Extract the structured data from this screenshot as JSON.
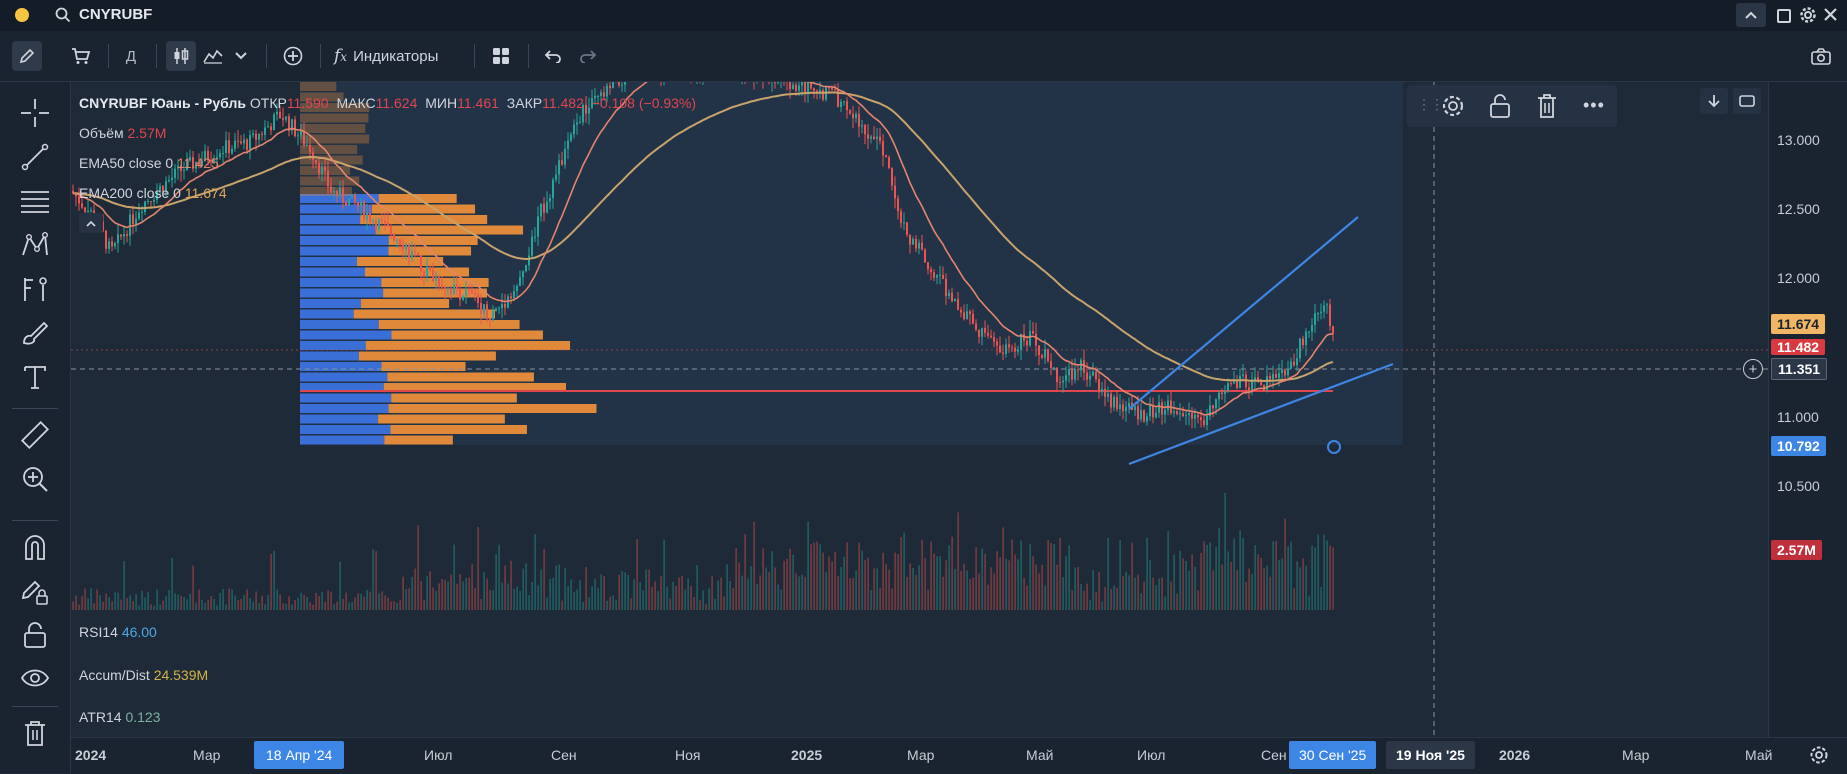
{
  "app": {
    "symbol_search": "CNYRUBF",
    "status_dot_color": "#f5c542"
  },
  "toolbar": {
    "timeframe": "Д",
    "indicators_label": "Индикаторы"
  },
  "legend": {
    "title": "CNYRUBF Юань - Рубль",
    "open_label": "ОТКР",
    "open_value": "11.590",
    "high_label": "МАКС",
    "high_value": "11.624",
    "low_label": "МИН",
    "low_value": "11.461",
    "close_label": "ЗАКР",
    "close_value": "11.482",
    "change": "−0.108 (−0.93%)",
    "volume_label": "Объём",
    "volume_value": "2.57M",
    "ema50_label": "EMA50 close 0",
    "ema50_value": "11.425",
    "ema200_label": "EMA200 close 0",
    "ema200_value": "11.674",
    "rsi_label": "RSI14",
    "rsi_value": "46.00",
    "accum_label": "Accum/Dist",
    "accum_value": "24.539M",
    "atr_label": "ATR14",
    "atr_value": "0.123"
  },
  "price_axis": {
    "ticks": [
      "13.000",
      "12.500",
      "12.000",
      "11.000",
      "10.500"
    ],
    "ema200_badge": "11.674",
    "close_badge": "11.482",
    "crosshair_badge": "11.351",
    "low_badge": "10.792",
    "volume_badge": "2.57M"
  },
  "time_axis": {
    "ticks": [
      "2024",
      "Мар",
      "Июл",
      "Сен",
      "Ноя",
      "2025",
      "Мар",
      "Май",
      "Июл",
      "Сен",
      "2026",
      "Мар",
      "Май"
    ],
    "highlight_start": "18 Апр '24",
    "highlight_end": "30 Сен '25",
    "crosshair_date": "19 Ноя '25"
  },
  "colors": {
    "background": "#1e2a38",
    "up": "#26a69a",
    "down": "#ef5350",
    "ema50": "#e4846c",
    "ema200": "#c9a36a",
    "trendline": "#3d86e6",
    "volume_profile_blue": "#3a6fd8",
    "volume_profile_orange": "#e0893a"
  }
}
